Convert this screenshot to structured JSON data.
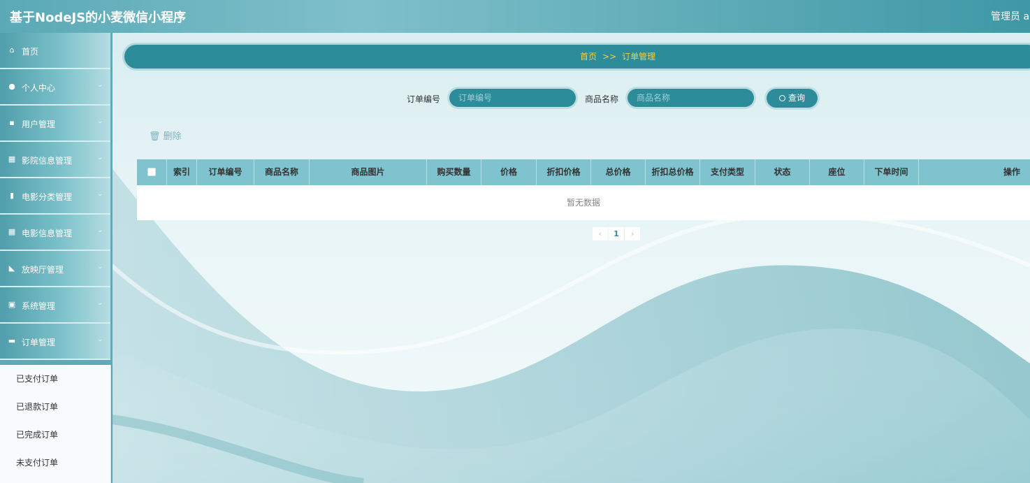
{
  "app": {
    "title": "基于NodeJS的小麦微信小程序",
    "user": "管理员 ab"
  },
  "sidebar": {
    "items": [
      {
        "label": "首页",
        "icon": "home-icon",
        "glyph": "⌂",
        "chevron": false
      },
      {
        "label": "个人中心",
        "icon": "user-icon",
        "glyph": "●",
        "chevron": true
      },
      {
        "label": "用户管理",
        "icon": "users-icon",
        "glyph": "▪",
        "chevron": true
      },
      {
        "label": "影院信息管理",
        "icon": "grid-icon",
        "glyph": "▦",
        "chevron": true
      },
      {
        "label": "电影分类管理",
        "icon": "bar-chart-icon",
        "glyph": "▮",
        "chevron": true
      },
      {
        "label": "电影信息管理",
        "icon": "grid-icon",
        "glyph": "▦",
        "chevron": true
      },
      {
        "label": "放映厅管理",
        "icon": "thumbs-up-icon",
        "glyph": "◣",
        "chevron": true
      },
      {
        "label": "系统管理",
        "icon": "clipboard-icon",
        "glyph": "▣",
        "chevron": true
      },
      {
        "label": "订单管理",
        "icon": "order-icon",
        "glyph": "▬",
        "chevron": true
      }
    ],
    "submenu": [
      "已支付订单",
      "已退款订单",
      "已完成订单",
      "未支付订单"
    ]
  },
  "breadcrumb": {
    "home": "首页",
    "separator": ">>",
    "current": "订单管理"
  },
  "search": {
    "order_no_label": "订单编号",
    "order_no_placeholder": "订单编号",
    "product_label": "商品名称",
    "product_placeholder": "商品名称",
    "query_label": "查询"
  },
  "toolbar": {
    "delete_label": "删除"
  },
  "table": {
    "columns": [
      "索引",
      "订单编号",
      "商品名称",
      "商品图片",
      "购买数量",
      "价格",
      "折扣价格",
      "总价格",
      "折扣总价格",
      "支付类型",
      "状态",
      "座位",
      "下单时间",
      "操作"
    ],
    "empty_text": "暂无数据"
  },
  "pagination": {
    "current_page": "1"
  },
  "colors": {
    "accent": "#2d8c99",
    "highlight": "#f4d03f"
  }
}
